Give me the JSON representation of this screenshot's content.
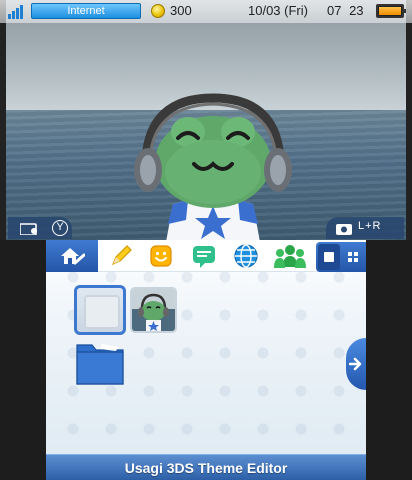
{
  "status_bar": {
    "network_label": "Internet",
    "coin_count": "300",
    "date": "10/03 (Fri)",
    "time": "07 23"
  },
  "top_screen": {
    "camera_left_button": "Y",
    "camera_right_buttons": "L+R"
  },
  "toolbar": {
    "icons": [
      "home-settings-icon",
      "pencil-icon",
      "miiverse-face-icon",
      "notifications-icon",
      "browser-globe-icon",
      "friends-icon"
    ]
  },
  "bottom_screen": {
    "footer_title": "Usagi 3DS Theme Editor"
  },
  "colors": {
    "accent_blue": "#2d5fa8",
    "internet_blue": "#1d8fe0",
    "battery_orange": "#f08c00"
  }
}
